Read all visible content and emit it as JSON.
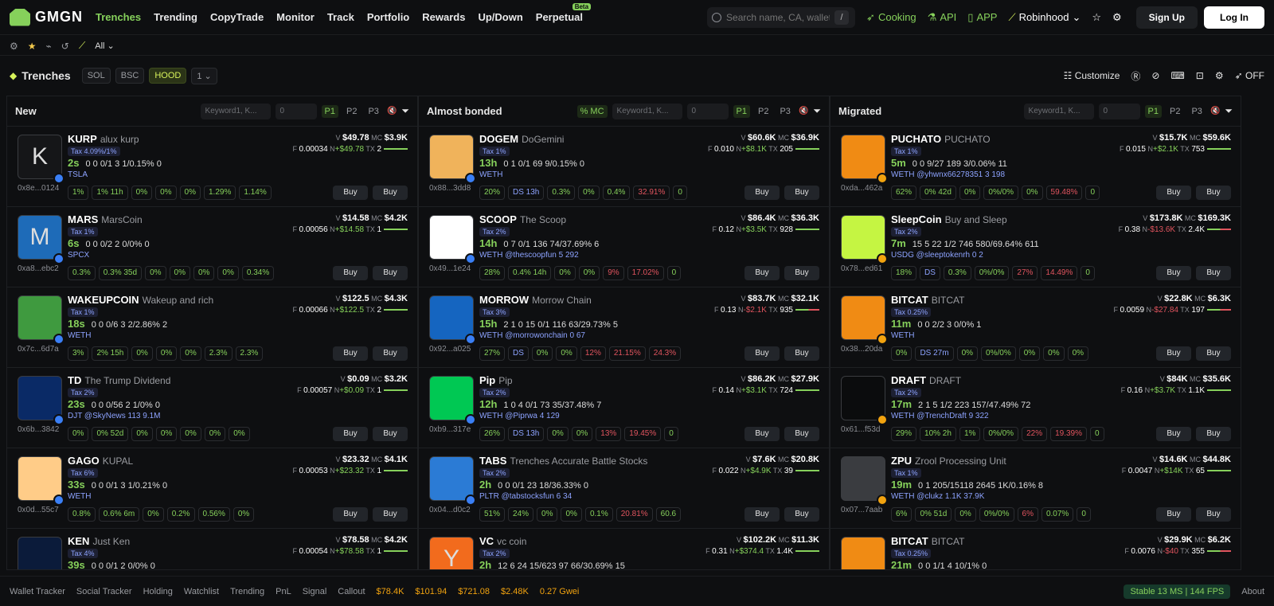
{
  "nav": {
    "logo": "GMGN",
    "items": [
      "Trenches",
      "Trending",
      "CopyTrade",
      "Monitor",
      "Track",
      "Portfolio",
      "Rewards",
      "Up/Down",
      "Perpetual"
    ],
    "beta": "Beta",
    "search_placeholder": "Search name, CA, wallet",
    "slash": "/",
    "cooking": "Cooking",
    "api": "API",
    "app": "APP",
    "robinhood": "Robinhood",
    "signup": "Sign Up",
    "login": "Log In"
  },
  "subbar": {
    "filter": "All"
  },
  "trenches": {
    "title": "Trenches",
    "chains": [
      "SOL",
      "BSC",
      "HOOD"
    ],
    "page_select": "1",
    "customize": "Customize",
    "off": "OFF"
  },
  "columns": [
    {
      "title": "New",
      "keyword_placeholder": "Keyword1, K...",
      "min": "0",
      "pages": [
        "P1",
        "P2",
        "P3"
      ],
      "rows": [
        {
          "letter": "K",
          "symbol": "KURP",
          "name": "alux kurp",
          "tax": "Tax 4.09%/1%",
          "age": "2s",
          "stats": "0  0  0/1  3  1/0.15%  0",
          "tag": "TSLA",
          "addr": "0x8e...0124",
          "v": "$49.78",
          "mc": "$3.9K",
          "f": "0.00034",
          "n": "+$49.78",
          "tx": "2",
          "pills": [
            "1%",
            "1% 11h",
            "0%",
            "0%",
            "0%",
            "1.29%",
            "1.14%"
          ]
        },
        {
          "letter": "M",
          "symbol": "MARS",
          "name": "MarsCoin",
          "tax": "Tax 1%",
          "age": "6s",
          "stats": "0  0  0/2  2  0/0%  0",
          "tag": "SPCX",
          "addr": "0xa8...ebc2",
          "v": "$14.58",
          "mc": "$4.2K",
          "f": "0.00056",
          "n": "+$14.58",
          "tx": "1",
          "pills": [
            "0.3%",
            "0.3% 35d",
            "0%",
            "0%",
            "0%",
            "0%",
            "0.34%"
          ]
        },
        {
          "letter": "",
          "symbol": "WAKEUPCOIN",
          "name": "Wakeup and rich",
          "tax": "Tax 1%",
          "age": "18s",
          "stats": "0  0  0/6  3  2/2.86%  2",
          "tag": "WETH",
          "addr": "0x7c...6d7a",
          "v": "$122.5",
          "mc": "$4.3K",
          "f": "0.00066",
          "n": "+$122.5",
          "tx": "2",
          "pills": [
            "3%",
            "2% 15h",
            "0%",
            "0%",
            "0%",
            "2.3%",
            "2.3%"
          ]
        },
        {
          "letter": "",
          "symbol": "TD",
          "name": "The Trump Dividend",
          "tax": "Tax 2%",
          "age": "23s",
          "stats": "0  0  0/56  2  1/0%  0",
          "tag": "DJT  @SkyNews  113  9.1M",
          "addr": "0x6b...3842",
          "v": "$0.09",
          "mc": "$3.2K",
          "f": "0.00057",
          "n": "+$0.09",
          "tx": "1",
          "pills": [
            "0%",
            "0% 52d",
            "0%",
            "0%",
            "0%",
            "0%",
            "0%"
          ]
        },
        {
          "letter": "",
          "symbol": "GAGO",
          "name": "KUPAL",
          "tax": "Tax 6%",
          "age": "33s",
          "stats": "0  0  0/1  3  1/0.21%  0",
          "tag": "WETH",
          "addr": "0x0d...55c7",
          "v": "$23.32",
          "mc": "$4.1K",
          "f": "0.00053",
          "n": "+$23.32",
          "tx": "1",
          "pills": [
            "0.8%",
            "0.6% 6m",
            "0%",
            "0.2%",
            "0.56%",
            "0%"
          ]
        },
        {
          "letter": "",
          "symbol": "KEN",
          "name": "Just Ken",
          "tax": "Tax 4%",
          "age": "39s",
          "stats": "0  0  0/1  2  0/0%  0",
          "tag": "",
          "addr": "",
          "v": "$78.58",
          "mc": "$4.2K",
          "f": "0.00054",
          "n": "+$78.58",
          "tx": "1",
          "pills": []
        }
      ]
    },
    {
      "title": "Almost bonded",
      "sort": "% MC",
      "keyword_placeholder": "Keyword1, K...",
      "min": "0",
      "pages": [
        "P1",
        "P2",
        "P3"
      ],
      "rows": [
        {
          "letter": "",
          "symbol": "DOGEM",
          "name": "DoGemini",
          "tax": "Tax 1%",
          "age": "13h",
          "stats": "0  1  0/1  69  9/0.15%  0",
          "tag": "WETH",
          "addr": "0x88...3dd8",
          "v": "$60.6K",
          "mc": "$36.9K",
          "f": "0.010",
          "n": "+$8.1K",
          "tx": "205",
          "pills": [
            "20%",
            "DS 13h",
            "0.3%",
            "0%",
            "0.4%",
            "32.91%",
            "0"
          ]
        },
        {
          "letter": "",
          "symbol": "SCOOP",
          "name": "The Scoop",
          "tax": "Tax 2%",
          "age": "14h",
          "stats": "0  7  0/1  136  74/37.69%  6",
          "tag": "WETH  @thescoopfun  5  292",
          "addr": "0x49...1e24",
          "v": "$86.4K",
          "mc": "$36.3K",
          "f": "0.12",
          "n": "+$3.5K",
          "tx": "928",
          "pills": [
            "28%",
            "0.4% 14h",
            "0%",
            "0%",
            "9%",
            "17.02%",
            "0"
          ]
        },
        {
          "letter": "",
          "symbol": "MORROW",
          "name": "Morrow Chain",
          "tax": "Tax 3%",
          "age": "15h",
          "stats": "2  1  0  15  0/1  116  63/29.73%  5",
          "tag": "WETH  @morrowonchain  0  67",
          "addr": "0x92...a025",
          "v": "$83.7K",
          "mc": "$32.1K",
          "f": "0.13",
          "n": "-$2.1K",
          "tx": "935",
          "pills": [
            "27%",
            "DS",
            "0%",
            "0%",
            "12%",
            "21.15%",
            "24.3%"
          ]
        },
        {
          "letter": "",
          "symbol": "Pip",
          "name": "Pip",
          "tax": "Tax 2%",
          "age": "12h",
          "stats": "1  0  4  0/1  73  35/37.48%  7",
          "tag": "WETH  @Piprwa  4  129",
          "addr": "0xb9...317e",
          "v": "$86.2K",
          "mc": "$27.9K",
          "f": "0.14",
          "n": "+$3.1K",
          "tx": "724",
          "pills": [
            "26%",
            "DS 13h",
            "0%",
            "0%",
            "13%",
            "19.45%",
            "0"
          ]
        },
        {
          "letter": "",
          "symbol": "TABS",
          "name": "Trenches Accurate Battle Stocks",
          "tax": "Tax 2%",
          "age": "2h",
          "stats": "0  0  0/1  23  18/36.33%  0",
          "tag": "PLTR  @tabstocksfun  6  34",
          "addr": "0x04...d0c2",
          "v": "$7.6K",
          "mc": "$20.8K",
          "f": "0.022",
          "n": "+$4.9K",
          "tx": "39",
          "pills": [
            "51%",
            "24%",
            "0%",
            "0%",
            "0.1%",
            "20.81%",
            "60.6"
          ]
        },
        {
          "letter": "Y",
          "symbol": "VC",
          "name": "vc coin",
          "tax": "Tax 2%",
          "age": "2h",
          "stats": "12  6  24  15/623  97  66/30.69%  15",
          "tag": "",
          "addr": "",
          "v": "$102.2K",
          "mc": "$11.3K",
          "f": "0.31",
          "n": "+$374.4",
          "tx": "1.4K",
          "pills": []
        }
      ]
    },
    {
      "title": "Migrated",
      "keyword_placeholder": "Keyword1, K...",
      "min": "0",
      "pages": [
        "P1",
        "P2",
        "P3"
      ],
      "rows": [
        {
          "letter": "",
          "symbol": "PUCHATO",
          "name": "PUCHATO",
          "tax": "Tax 1%",
          "age": "5m",
          "stats": "0  0  9/27  189  3/0.06%  11",
          "tag": "WETH  @yhwnx66278351  3  198",
          "addr": "0xda...462a",
          "v": "$15.7K",
          "mc": "$59.6K",
          "f": "0.015",
          "n": "+$2.1K",
          "tx": "753",
          "pills": [
            "62%",
            "0% 42d",
            "0%",
            "0%/0%",
            "0%",
            "59.48%",
            "0"
          ]
        },
        {
          "letter": "",
          "symbol": "SleepCoin",
          "name": "Buy and Sleep",
          "tax": "Tax 2%",
          "age": "7m",
          "stats": "15  5  22  1/2  746  580/69.64%  611",
          "tag": "USDG  @sleeptokenrh  0  2",
          "addr": "0x78...ed61",
          "v": "$173.8K",
          "mc": "$169.3K",
          "f": "0.38",
          "n": "-$13.6K",
          "tx": "2.4K",
          "pills": [
            "18%",
            "DS",
            "0.3%",
            "0%/0%",
            "27%",
            "14.49%",
            "0"
          ]
        },
        {
          "letter": "",
          "symbol": "BITCAT",
          "name": "BITCAT",
          "tax": "Tax 0.25%",
          "age": "11m",
          "stats": "0  0  2/2  3  0/0%  1",
          "tag": "WETH",
          "addr": "0x38...20da",
          "v": "$22.8K",
          "mc": "$6.3K",
          "f": "0.0059",
          "n": "-$27.84",
          "tx": "197",
          "pills": [
            "0%",
            "DS 27m",
            "0%",
            "0%/0%",
            "0%",
            "0%",
            "0%"
          ]
        },
        {
          "letter": "",
          "symbol": "DRAFT",
          "name": "DRAFT",
          "tax": "Tax 2%",
          "age": "17m",
          "stats": "2  1  5  1/2  223  157/47.49%  72",
          "tag": "WETH  @TrenchDraft  9  322",
          "addr": "0x61...f53d",
          "v": "$84K",
          "mc": "$35.6K",
          "f": "0.16",
          "n": "+$3.7K",
          "tx": "1.1K",
          "pills": [
            "29%",
            "10% 2h",
            "1%",
            "0%/0%",
            "22%",
            "19.39%",
            "0"
          ]
        },
        {
          "letter": "",
          "symbol": "ZPU",
          "name": "Zrool Processing Unit",
          "tax": "Tax 1%",
          "age": "19m",
          "stats": "0  1  205/15118  2645  1K/0.16%  8",
          "tag": "WETH  @clukz  1.1K  37.9K",
          "addr": "0x07...7aab",
          "v": "$14.6K",
          "mc": "$44.8K",
          "f": "0.0047",
          "n": "+$14K",
          "tx": "65",
          "pills": [
            "6%",
            "0% 51d",
            "0%",
            "0%/0%",
            "6%",
            "0.07%",
            "0"
          ]
        },
        {
          "letter": "",
          "symbol": "BITCAT",
          "name": "BITCAT",
          "tax": "Tax 0.25%",
          "age": "21m",
          "stats": "0  0  1/1  4  10/1%  0",
          "tag": "",
          "addr": "",
          "v": "$29.9K",
          "mc": "$6.2K",
          "f": "0.0076",
          "n": "-$40",
          "tx": "355",
          "pills": []
        }
      ]
    }
  ],
  "buy_label": "Buy",
  "footer": {
    "items": [
      "Wallet Tracker",
      "Social Tracker",
      "Holding",
      "Watchlist",
      "Trending",
      "PnL",
      "Signal",
      "Callout"
    ],
    "prices": [
      "$78.4K",
      "$101.94",
      "$721.08",
      "$2.48K",
      "0.27 Gwei"
    ],
    "stable": "Stable 13 MS | 144 FPS",
    "about": "About"
  }
}
